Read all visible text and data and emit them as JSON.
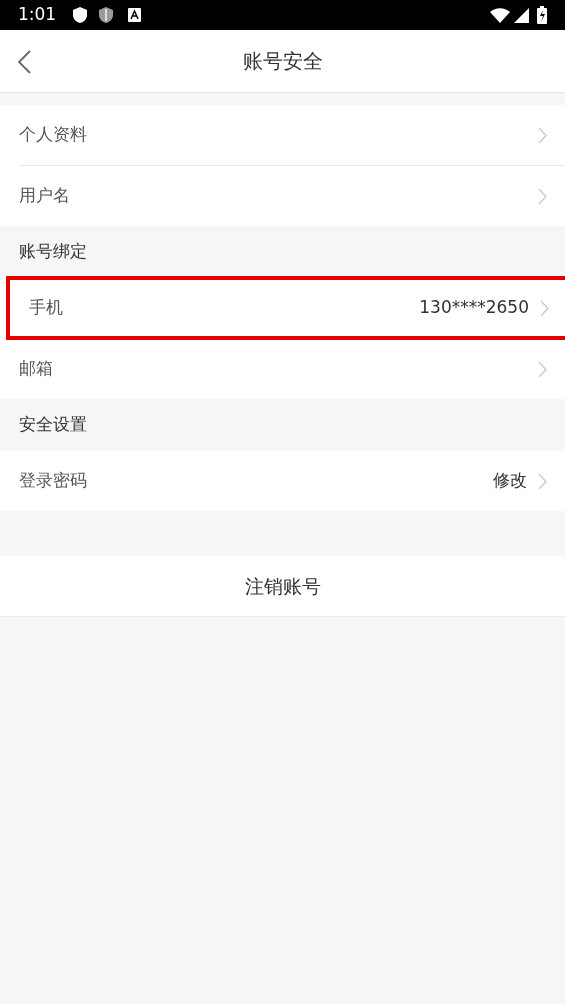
{
  "status_bar": {
    "time": "1:01"
  },
  "header": {
    "title": "账号安全"
  },
  "groups": [
    {
      "items": [
        {
          "label": "个人资料",
          "highlighted": false
        },
        {
          "label": "用户名",
          "highlighted": false
        }
      ]
    },
    {
      "title": "账号绑定",
      "items": [
        {
          "label": "手机",
          "value": "130****2650",
          "highlighted": true
        },
        {
          "label": "邮箱",
          "highlighted": false
        }
      ]
    },
    {
      "title": "安全设置",
      "items": [
        {
          "label": "登录密码",
          "value": "修改",
          "highlighted": false
        }
      ]
    }
  ],
  "cancel_button": {
    "label": "注销账号"
  }
}
